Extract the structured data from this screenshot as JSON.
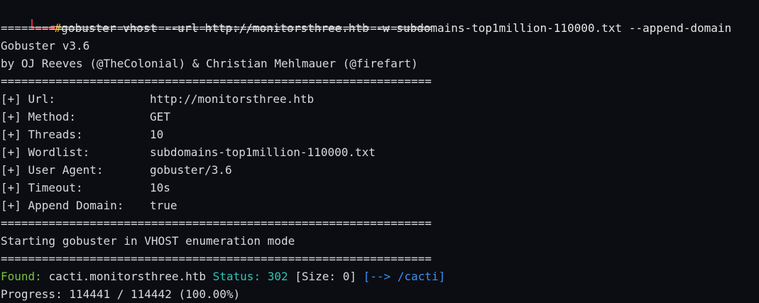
{
  "prompt": {
    "symbol": "#",
    "command": "gobuster vhost --url http://monitorsthree.htb -w subdomains-top1million-110000.txt --append-domain"
  },
  "separator": "===============================================================",
  "banner": {
    "name": "Gobuster v3.6",
    "authors": "by OJ Reeves (@TheColonial) & Christian Mehlmauer (@firefart)"
  },
  "config": [
    {
      "key": "[+] Url:",
      "value": "http://monitorsthree.htb"
    },
    {
      "key": "[+] Method:",
      "value": "GET"
    },
    {
      "key": "[+] Threads:",
      "value": "10"
    },
    {
      "key": "[+] Wordlist:",
      "value": "subdomains-top1million-110000.txt"
    },
    {
      "key": "[+] User Agent:",
      "value": "gobuster/3.6"
    },
    {
      "key": "[+] Timeout:",
      "value": "10s"
    },
    {
      "key": "[+] Append Domain:",
      "value": "true"
    }
  ],
  "start_message": "Starting gobuster in VHOST enumeration mode",
  "result": {
    "found_label": "Found:",
    "host": "cacti.monitorsthree.htb",
    "status_label": "Status:",
    "status_code": "302",
    "size": "[Size: 0]",
    "redirect": "[--> /cacti]"
  },
  "progress": "Progress: 114441 / 114442 (100.00%)",
  "colors": {
    "prompt_corner": "#e0263a",
    "hash": "#f5c518",
    "found": "#78c13c",
    "status": "#2ec4b6",
    "redirect": "#3b8ff5",
    "background": "#0b0d12"
  },
  "icons": {
    "prompt": "prompt-corner-icon"
  }
}
